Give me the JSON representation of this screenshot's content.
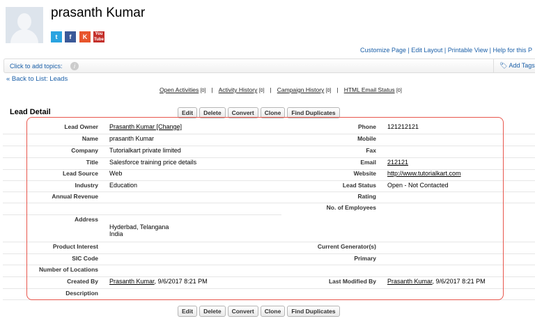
{
  "header": {
    "name": "prasanth Kumar",
    "social_icons": [
      "twitter-icon",
      "facebook-icon",
      "klout-icon",
      "youtube-icon"
    ]
  },
  "links": [
    "Customize Page",
    "Edit Layout",
    "Printable View",
    "Help for this P"
  ],
  "topics": {
    "label": "Click to add topics:",
    "add_tags": "Add Tags"
  },
  "back": "« Back to List: Leads",
  "related": [
    {
      "label": "Open Activities",
      "count": "[0]"
    },
    {
      "label": "Activity History",
      "count": "[0]"
    },
    {
      "label": "Campaign History",
      "count": "[0]"
    },
    {
      "label": "HTML Email Status",
      "count": "[0]"
    }
  ],
  "section_title": "Lead Detail",
  "buttons": [
    "Edit",
    "Delete",
    "Convert",
    "Clone",
    "Find Duplicates"
  ],
  "colors": {
    "link": "#1a5fa8",
    "highlight_box": "#e8564c"
  },
  "rows": [
    {
      "l1": "Lead Owner",
      "v1": "Prasanth Kumar [Change]",
      "u1": true,
      "l2": "Phone",
      "v2": "121212121"
    },
    {
      "l1": "Name",
      "v1": "prasanth Kumar",
      "l2": "Mobile",
      "v2": ""
    },
    {
      "l1": "Company",
      "v1": "Tutorialkart private limited",
      "l2": "Fax",
      "v2": ""
    },
    {
      "l1": "Title",
      "v1": "Salesforce training price details",
      "l2": "Email",
      "v2": "212121",
      "u2": true
    },
    {
      "l1": "Lead Source",
      "v1": "Web",
      "l2": "Website",
      "v2": "http://www.tutorialkart.com",
      "u2": true
    },
    {
      "l1": "Industry",
      "v1": "Education",
      "l2": "Lead Status",
      "v2": "Open - Not Contacted"
    },
    {
      "l1": "Annual Revenue",
      "v1": "",
      "l2": "Rating",
      "v2": ""
    },
    {
      "l1": "",
      "v1": "",
      "l2": "No. of Employees",
      "v2": ""
    },
    {
      "l1": "Address",
      "v1": "Hyderbad, Telangana",
      "v1b": "India",
      "l2": "",
      "v2": ""
    },
    {
      "l1": "Product Interest",
      "v1": "",
      "l2": "Current Generator(s)",
      "v2": ""
    },
    {
      "l1": "SIC Code",
      "v1": "",
      "l2": "Primary",
      "v2": ""
    },
    {
      "l1": "Number of Locations",
      "v1": "",
      "l2": "",
      "v2": ""
    },
    {
      "l1": "Created By",
      "v1": "Prasanth Kumar",
      "v1s": ", 9/6/2017 8:21 PM",
      "u1": true,
      "l2": "Last Modified By",
      "v2": "Prasanth Kumar",
      "v2s": ", 9/6/2017 8:21 PM",
      "u2": true
    },
    {
      "l1": "Description",
      "v1": "",
      "l2": "",
      "v2": ""
    }
  ]
}
